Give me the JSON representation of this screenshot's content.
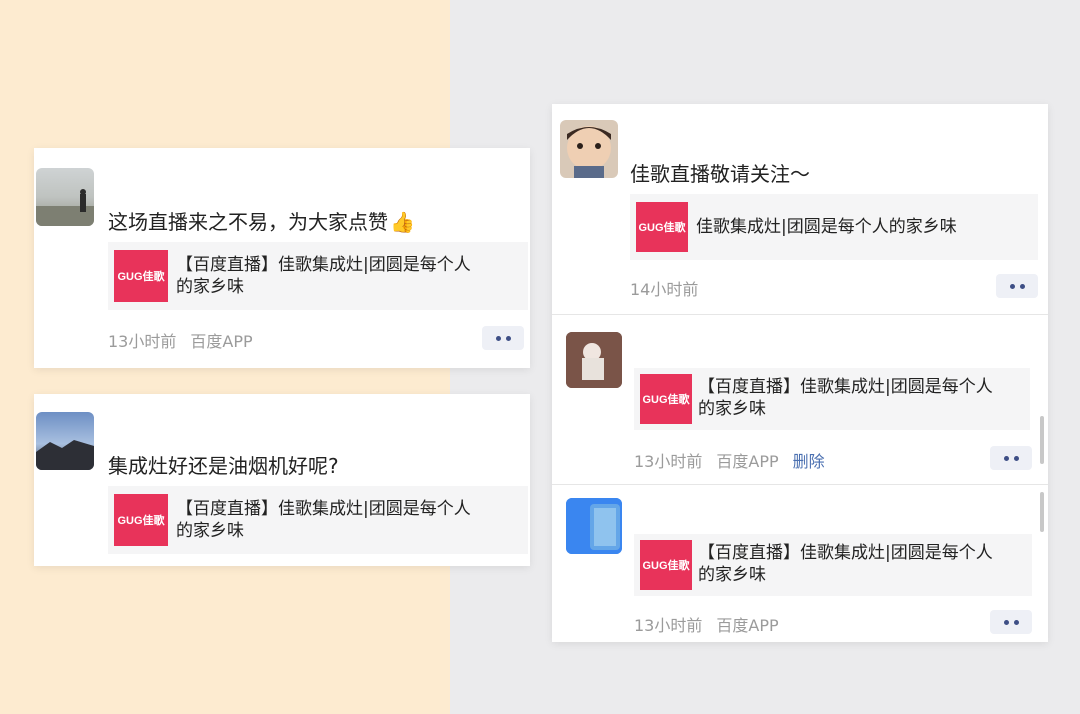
{
  "left": {
    "comments": [
      {
        "text": "这场直播来之不易，为大家点赞",
        "emoji": "👍",
        "link": {
          "logo": "GUG佳歌",
          "title": "【百度直播】佳歌集成灶|团圆是每个人",
          "title2": "的家乡味"
        },
        "time": "13小时前",
        "source": "百度APP"
      },
      {
        "text": "集成灶好还是油烟机好呢?",
        "link": {
          "logo": "GUG佳歌",
          "title": "【百度直播】佳歌集成灶|团圆是每个人",
          "title2": "的家乡味"
        }
      }
    ]
  },
  "right": {
    "comments": [
      {
        "text": "佳歌直播敬请关注～",
        "link": {
          "logo": "GUG佳歌",
          "title": "佳歌集成灶|团圆是每个人的家乡味"
        },
        "time": "14小时前"
      },
      {
        "link": {
          "logo": "GUG佳歌",
          "title": "【百度直播】佳歌集成灶|团圆是每个人",
          "title2": "的家乡味"
        },
        "time": "13小时前",
        "source": "百度APP",
        "delete": "删除"
      },
      {
        "link": {
          "logo": "GUG佳歌",
          "title": "【百度直播】佳歌集成灶|团圆是每个人",
          "title2": "的家乡味"
        },
        "time": "13小时前",
        "source": "百度APP"
      }
    ]
  },
  "colors": {
    "brand": "#e8335a",
    "link_blue": "#4a6fb0",
    "meta_gray": "#9b9b9b"
  }
}
